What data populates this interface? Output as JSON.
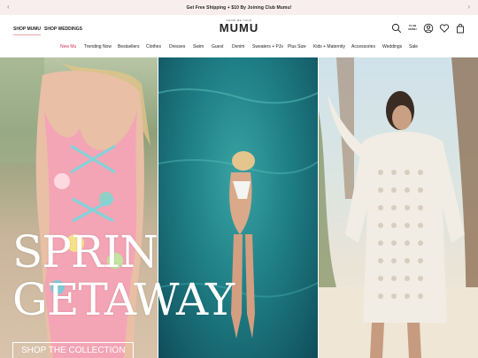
{
  "promo": {
    "text": "Get Free Shipping + $10 By Joining Club Mumu!",
    "prev_arrow": "‹",
    "next_arrow": "›"
  },
  "header": {
    "top_links": [
      "SHOP MUMU",
      "SHOP WEDDINGS"
    ],
    "logo_tagline": "SHOW ME YOUR",
    "logo": "MUMU",
    "club_label_top": "CLUB",
    "club_label_bottom": "MUMU",
    "icons": [
      "search-icon",
      "club-mumu-icon",
      "account-icon",
      "wishlist-icon",
      "bag-icon"
    ]
  },
  "nav": {
    "items": [
      "New Mu",
      "Trending Now",
      "Bestsellers",
      "Clothes",
      "Dresses",
      "Swim",
      "Guest",
      "Denim",
      "Sweaters + PJs",
      "Plus Size",
      "Kids + Maternity",
      "Accessories",
      "Weddings",
      "Sale"
    ],
    "accent_color": "#d4335a"
  },
  "hero": {
    "headline_line1": "SPRING",
    "headline_line2": "GETAWAY",
    "cta": "SHOP THE COLLECTION"
  }
}
